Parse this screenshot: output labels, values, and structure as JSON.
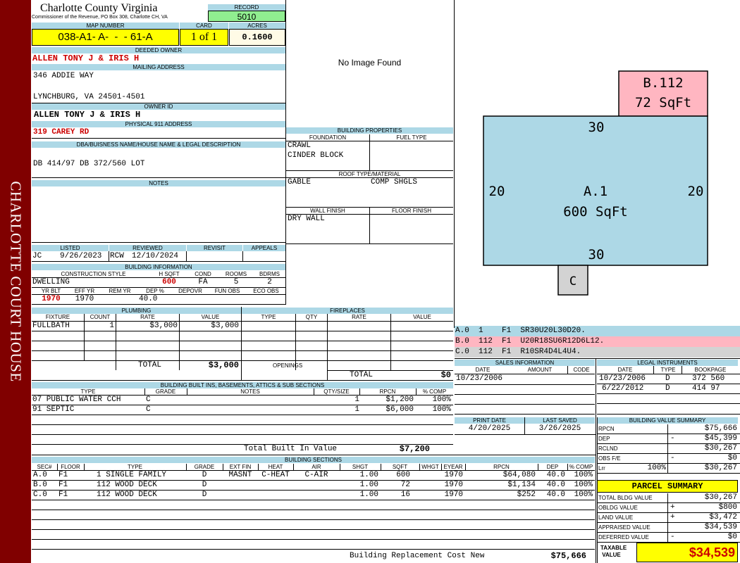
{
  "sidebar": {
    "text": "CHARLOTTE COURT HOUSE"
  },
  "header": {
    "county": "Charlotte County Virginia",
    "address": "Commissioner of the Revenue, PO Box 308, Charlotte CH, VA",
    "record_label": "RECORD",
    "record": "5010",
    "map_label": "MAP NUMBER",
    "map": "038-A1- A-  -  - 61-A",
    "card_label": "CARD",
    "card": "1 of 1",
    "acres_label": "ACRES",
    "acres": "0.1600"
  },
  "owner": {
    "deeded_label": "DEEDED OWNER",
    "deeded": "ALLEN TONY J & IRIS H",
    "mailing_label": "MAILING ADDRESS",
    "mail1": "346 ADDIE WAY",
    "mail2": "LYNCHBURG, VA 24501-4501",
    "ownerid_label": "OWNER ID",
    "ownerid": "ALLEN TONY J & IRIS H",
    "phys_label": "PHYSICAL 911 ADDRESS",
    "phys": "319 CAREY RD",
    "dba_label": "DBA/BUISNESS NAME/HOUSE NAME & LEGAL DESCRIPTION",
    "dba": "DB 414/97 DB 372/560 LOT",
    "notes_label": "NOTES"
  },
  "image_text": "No Image Found",
  "building_props": {
    "title": "BUILDING PROPERTIES",
    "foundation_label": "FOUNDATION",
    "fuel_label": "FUEL TYPE",
    "foundation1": "CRAWL",
    "foundation2": "CINDER BLOCK",
    "roof_label": "ROOF TYPE/MATERIAL",
    "roof1": "GABLE",
    "roof2": "COMP SHGLS",
    "wall_label": "WALL FINISH",
    "floor_label": "FLOOR FINISH",
    "wall": "DRY WALL"
  },
  "listed": {
    "listed_label": "LISTED",
    "reviewed_label": "REVIEWED",
    "revisit_label": "REVISIT",
    "appeals_label": "APPEALS",
    "listed_by": "JC",
    "listed_date": "9/26/2023",
    "reviewed_by": "RCW",
    "reviewed_date": "12/10/2024"
  },
  "building_info": {
    "title": "BUILDING INFORMATION",
    "style_label": "CONSTRUCTION STYLE",
    "hsqft_label": "H SQFT",
    "cond_label": "COND",
    "rooms_label": "ROOMS",
    "bdrms_label": "BDRMS",
    "style": "DWELLING",
    "hsqft": "600",
    "cond": "FA",
    "rooms": "5",
    "bdrms": "2",
    "yrblt_label": "YR BLT",
    "effyr_label": "EFF YR",
    "remyr_label": "REM YR",
    "dep_label": "DEP %",
    "depovr_label": "DEPOVR",
    "funobs_label": "FUN OBS",
    "ecoobs_label": "ECO OBS",
    "yrblt": "1970",
    "effyr": "1970",
    "dep": "40.0"
  },
  "plumbing": {
    "title": "PLUMBING",
    "cols": [
      "FIXTURE",
      "COUNT",
      "RATE",
      "VALUE"
    ],
    "rows": [
      {
        "fixture": "FULLBATH",
        "count": "1",
        "rate": "$3,000",
        "value": "$3,000"
      }
    ],
    "total_label": "TOTAL",
    "total": "$3,000"
  },
  "fireplaces": {
    "title": "FIREPLACES",
    "cols": [
      "TYPE",
      "QTY",
      "RATE",
      "VALUE"
    ],
    "openings_label": "OPENINGS",
    "total_label": "TOTAL",
    "total": "$0"
  },
  "builtins": {
    "title": "BUILDING BUILT INS, BASEMENTS, ATTICS & SUB SECTIONS",
    "cols": [
      "TYPE",
      "GRADE",
      "NOTES",
      "QTY/SIZE",
      "RPCN",
      "% COMP"
    ],
    "rows": [
      {
        "type": "07 PUBLIC WATER CCH",
        "grade": "C",
        "qty": "1",
        "rpcn": "$1,200",
        "comp": "100%"
      },
      {
        "type": "91 SEPTIC",
        "grade": "C",
        "qty": "1",
        "rpcn": "$6,000",
        "comp": "100%"
      }
    ],
    "total_label": "Total Built In Value",
    "total": "$7,200"
  },
  "sections": {
    "title": "BUILDING SECTIONS",
    "cols": [
      "SEC#",
      "FLOOR",
      "TYPE",
      "GRADE",
      "EXT FIN",
      "HEAT",
      "AIR",
      "SHGT",
      "SQFT",
      "WHGT",
      "EYEAR",
      "RPCN",
      "DEP",
      "% COMP"
    ],
    "rows": [
      {
        "sec": "A.0",
        "floor": "F1",
        "type": "1 SINGLE FAMILY",
        "grade": "D",
        "ext": "MASNT",
        "heat": "C-HEAT",
        "air": "C-AIR",
        "shgt": "1.00",
        "sqft": "600",
        "eyear": "1970",
        "rpcn": "$64,080",
        "dep": "40.0",
        "comp": "100%"
      },
      {
        "sec": "B.0",
        "floor": "F1",
        "type": "112 WOOD DECK",
        "grade": "D",
        "ext": "",
        "heat": "",
        "air": "",
        "shgt": "1.00",
        "sqft": "72",
        "eyear": "1970",
        "rpcn": "$1,134",
        "dep": "40.0",
        "comp": "100%"
      },
      {
        "sec": "C.0",
        "floor": "F1",
        "type": "112 WOOD DECK",
        "grade": "D",
        "ext": "",
        "heat": "",
        "air": "",
        "shgt": "1.00",
        "sqft": "16",
        "eyear": "1970",
        "rpcn": "$252",
        "dep": "40.0",
        "comp": "100%"
      }
    ],
    "total_label": "Building Replacement Cost New",
    "total": "$75,666"
  },
  "sketch": {
    "b_label": "B.112",
    "b_area": "72 SqFt",
    "a_label": "A.1",
    "a_area": "600 SqFt",
    "top": "30",
    "bottom": "30",
    "left": "20",
    "right": "20",
    "c_label": "C",
    "colors": {
      "main": "#add8e6",
      "deck": "#ffb6c1",
      "c": "#d3d3d3"
    }
  },
  "vectors": [
    {
      "text": "A.0  1    F1  SR30U20L30D20.",
      "color": "#add8e6"
    },
    {
      "text": "B.0  112  F1  U20R18SU6R12D6L12.",
      "color": "#ffb6c1"
    },
    {
      "text": "C.0  112  F1  R10SR4D4L4U4.",
      "color": "#d3d3d3"
    }
  ],
  "sales": {
    "title": "SALES INFORMATION",
    "cols": [
      "DATE",
      "AMOUNT",
      "CODE"
    ],
    "rows": [
      {
        "date": "10/23/2006"
      }
    ]
  },
  "legal": {
    "title": "LEGAL INSTRUMENTS",
    "cols": [
      "DATE",
      "TYPE",
      "BOOKPAGE"
    ],
    "rows": [
      {
        "date": "10/23/2006",
        "type": "D",
        "book": "372 560"
      },
      {
        "date": "6/22/2012",
        "type": "D",
        "book": "414 97"
      }
    ]
  },
  "print": {
    "print_label": "PRINT DATE",
    "print": "4/20/2025",
    "saved_label": "LAST SAVED",
    "saved": "3/26/2025"
  },
  "value_summary": {
    "title": "BUILDING VALUE SUMMARY",
    "rows": [
      {
        "label": "RPCN",
        "sign": "",
        "value": "$75,666"
      },
      {
        "label": "DEP",
        "sign": "-",
        "value": "$45,399"
      },
      {
        "label": "RCLND",
        "sign": "",
        "value": "$30,267"
      },
      {
        "label": "OBS F/E",
        "sign": "-",
        "value": "$0"
      },
      {
        "label": "Lrr",
        "pct": "100%",
        "sign": "",
        "value": "$30,267"
      }
    ]
  },
  "parcel": {
    "title": "PARCEL SUMMARY",
    "rows": [
      {
        "label": "TOTAL BLDG VALUE",
        "sign": "",
        "value": "$30,267"
      },
      {
        "label": "OBLDG VALUE",
        "sign": "+",
        "value": "$800"
      },
      {
        "label": "LAND VALUE",
        "sign": "+",
        "value": "$3,472"
      },
      {
        "label": "APPRAISED VALUE",
        "sign": "",
        "value": "$34,539"
      },
      {
        "label": "DEFERRED VALUE",
        "sign": "-",
        "value": "$0"
      }
    ],
    "taxable_label1": "TAXABLE",
    "taxable_label2": "VALUE",
    "taxable": "$34,539"
  }
}
